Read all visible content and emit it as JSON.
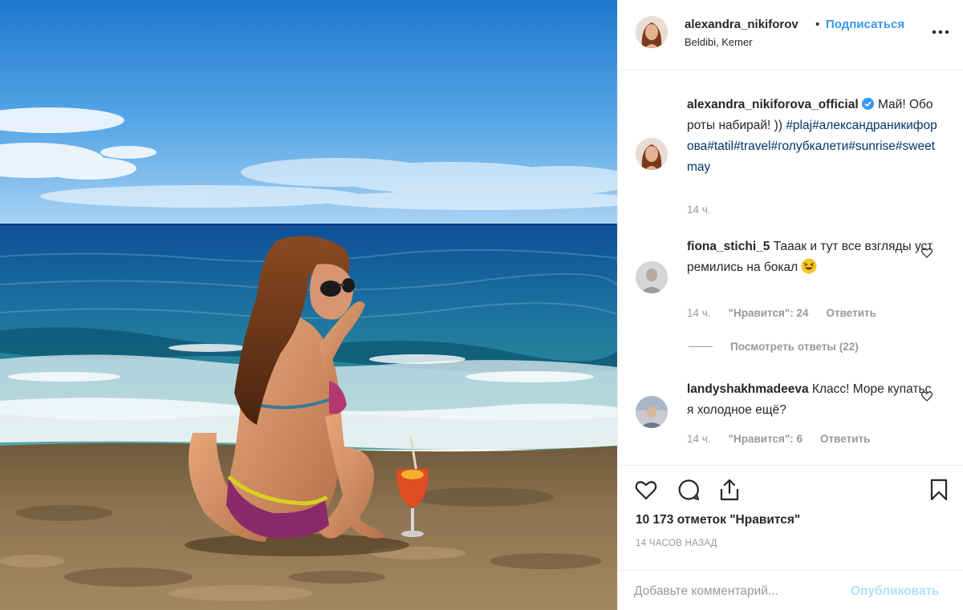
{
  "header": {
    "username": "alexandra_nikiforov",
    "separator": "•",
    "follow_label": "Подписаться",
    "location": "Beldibi, Kemer"
  },
  "caption": {
    "username": "alexandra_nikiforova_official",
    "text_line1": "Май!",
    "text_line2": "Обороты набирай! ))",
    "hashtags": [
      "#plaj",
      "#александраникифорова",
      "#tatil",
      "#travel",
      "#голубкалети",
      "#sunrise",
      "#sweetmay"
    ],
    "time": "14 ч."
  },
  "comments": [
    {
      "username": "fiona_stichi_5",
      "text": "Тааак и тут все взгляды устремились на бокал",
      "emoji": "laughing-face",
      "time": "14 ч.",
      "likes_label": "\"Нравится\": 24",
      "reply_label": "Ответить"
    },
    {
      "username": "landyshakhmadeeva",
      "text": "Класс! Море купаться холодное ещё?",
      "time": "14 ч.",
      "likes_label": "\"Нравится\": 6",
      "reply_label": "Ответить"
    }
  ],
  "view_replies_label": "Посмотреть ответы (22)",
  "likes_count": "10 173 отметок \"Нравится\"",
  "time_ago": "14 ЧАСОВ НАЗАД",
  "add_comment": {
    "placeholder": "Добавьте комментарий...",
    "publish_label": "Опубликовать"
  },
  "colors": {
    "link_blue": "#3897f0",
    "hashtag": "#003569",
    "muted": "#999999",
    "publish_disabled": "#b2dffc"
  }
}
